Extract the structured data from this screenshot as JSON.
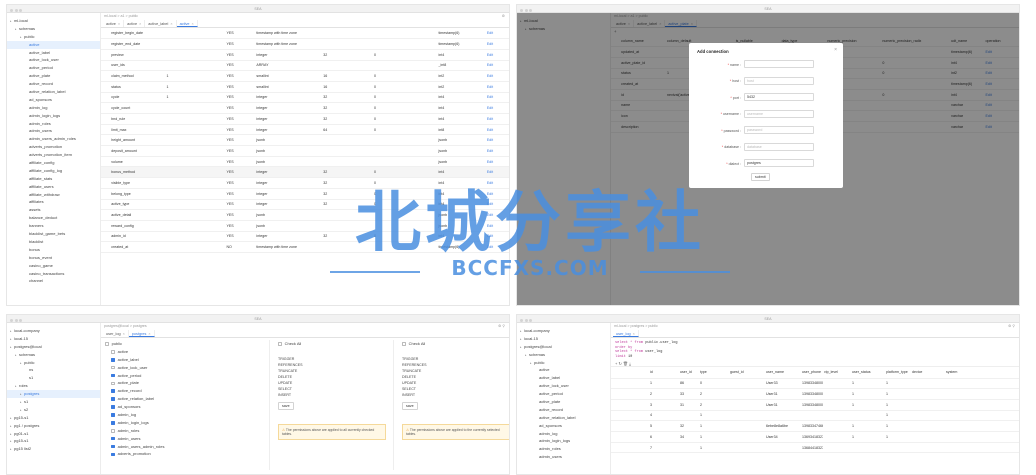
{
  "win_title": "SEA",
  "w1": {
    "breadcrumb": "ml-local > a1 > public",
    "settings_glyph": "⚙",
    "tree": [
      "ml-local",
      "schemas",
      "public",
      "active",
      "active_label",
      "active_lock_user",
      "active_period",
      "active_plate",
      "active_record",
      "active_relation_label",
      "ad_sponsors",
      "admin_log",
      "admin_login_logs",
      "admin_roles",
      "admin_users",
      "admin_users_admin_roles",
      "adverts_promotion",
      "adverts_promotion_item",
      "affiliate_config",
      "affiliate_config_log",
      "affiliate_stats",
      "affiliate_users",
      "affiliate_withdraw",
      "affiliates",
      "assets",
      "balance_deduct",
      "banners",
      "blacklist_game_bets",
      "blacklist",
      "bonus",
      "bonus_event",
      "casino_game",
      "casino_transactions",
      "channel"
    ],
    "tabs": [
      {
        "label": "active",
        "close": "×"
      },
      {
        "label": "active",
        "close": "×"
      },
      {
        "label": "active_label",
        "close": "×"
      },
      {
        "label": "active",
        "close": "×"
      }
    ],
    "rows": [
      [
        "",
        "register_begin_date",
        "",
        "YES",
        "timestamp with time zone",
        "",
        "",
        "timestamp(6)",
        "Edit"
      ],
      [
        "",
        "register_end_date",
        "",
        "YES",
        "timestamp with time zone",
        "",
        "",
        "timestamp(6)",
        "Edit"
      ],
      [
        "",
        "preview",
        "",
        "YES",
        "integer",
        "32",
        "0",
        "int4",
        "Edit"
      ],
      [
        "",
        "user_ids",
        "",
        "YES",
        "ARRAY",
        "",
        "",
        "_int8",
        "Edit"
      ],
      [
        "",
        "claim_method",
        "1",
        "YES",
        "smallint",
        "16",
        "0",
        "int2",
        "Edit"
      ],
      [
        "",
        "status",
        "1",
        "YES",
        "smallint",
        "16",
        "0",
        "int2",
        "Edit"
      ],
      [
        "",
        "cycle",
        "1",
        "YES",
        "integer",
        "32",
        "0",
        "int4",
        "Edit"
      ],
      [
        "",
        "cycle_count",
        "",
        "YES",
        "integer",
        "32",
        "0",
        "int4",
        "Edit"
      ],
      [
        "",
        "bnd_rule",
        "",
        "YES",
        "integer",
        "32",
        "0",
        "int4",
        "Edit"
      ],
      [
        "",
        "limit_max",
        "",
        "YES",
        "integer",
        "64",
        "0",
        "int8",
        "Edit"
      ],
      [
        "",
        "height_amount",
        "",
        "YES",
        "jsonb",
        "",
        "",
        "jsonb",
        "Edit"
      ],
      [
        "",
        "deposit_amount",
        "",
        "YES",
        "jsonb",
        "",
        "",
        "jsonb",
        "Edit"
      ],
      [
        "",
        "volume",
        "",
        "YES",
        "jsonb",
        "",
        "",
        "jsonb",
        "Edit"
      ],
      [
        "",
        "bonus_method",
        "",
        "YES",
        "integer",
        "32",
        "0",
        "int4",
        "Edit"
      ],
      [
        "",
        "visible_type",
        "",
        "YES",
        "integer",
        "32",
        "0",
        "int4",
        "Edit"
      ],
      [
        "",
        "belong_type",
        "",
        "YES",
        "integer",
        "32",
        "0",
        "int4",
        "Edit"
      ],
      [
        "",
        "active_type",
        "",
        "YES",
        "integer",
        "32",
        "0",
        "int4",
        "Edit"
      ],
      [
        "",
        "active_detail",
        "",
        "YES",
        "jsonb",
        "",
        "",
        "jsonb",
        "Edit"
      ],
      [
        "",
        "reward_config",
        "",
        "YES",
        "jsonb",
        "",
        "",
        "jsonb",
        "Edit"
      ],
      [
        "",
        "admin_id",
        "",
        "YES",
        "integer",
        "32",
        "0",
        "int4",
        "Edit"
      ],
      [
        "",
        "created_at",
        "",
        "NO",
        "timestamp with time zone",
        "",
        "",
        "timestamp(6)",
        "Edit"
      ]
    ]
  },
  "w2": {
    "breadcrumb": "ml-local > a1 > public",
    "tree": [
      "ml-local",
      "schemas"
    ],
    "tabs": [
      {
        "label": "active",
        "close": "×"
      },
      {
        "label": "active_label",
        "close": "×"
      },
      {
        "label": "active_plate",
        "close": "×"
      }
    ],
    "add_glyph": "+",
    "headers": [
      "column_name",
      "column_default",
      "is_nullable",
      "data_type",
      "numeric_precision",
      "numeric_precision_radix",
      "udt_name",
      "operation"
    ],
    "rows": [
      [
        "updated_at",
        "",
        "",
        "",
        "",
        "",
        "timestamp(6)",
        "Edit"
      ],
      [
        "active_plate_id",
        "",
        "",
        "",
        "32",
        "0",
        "int4",
        "Edit"
      ],
      [
        "status",
        "1",
        "",
        "",
        "16",
        "0",
        "int2",
        "Edit"
      ],
      [
        "created_at",
        "",
        "",
        "",
        "",
        "",
        "timestamp(6)",
        "Edit"
      ],
      [
        "id",
        "nextval('active_plate_id_seq'::regclass)",
        "",
        "",
        "32",
        "0",
        "int4",
        "Edit"
      ],
      [
        "name",
        "",
        "",
        "",
        "",
        "",
        "varchar",
        "Edit"
      ],
      [
        "icon",
        "",
        "",
        "",
        "",
        "",
        "varchar",
        "Edit"
      ],
      [
        "description",
        "",
        "",
        "",
        "",
        "",
        "varchar",
        "Edit"
      ]
    ],
    "dialog": {
      "title": "Add connection",
      "close": "×",
      "fields": [
        {
          "label": "name",
          "value": "",
          "placeholder": ""
        },
        {
          "label": "host",
          "value": "",
          "placeholder": "host"
        },
        {
          "label": "port",
          "value": "5432",
          "placeholder": ""
        },
        {
          "label": "username",
          "value": "",
          "placeholder": "username"
        },
        {
          "label": "password",
          "value": "",
          "placeholder": "password"
        },
        {
          "label": "database",
          "value": "",
          "placeholder": "database"
        },
        {
          "label": "dialect",
          "value": "postgres",
          "placeholder": ""
        }
      ],
      "submit": "submit"
    }
  },
  "w3": {
    "breadcrumb": "postgres@local > postgres",
    "icons": "⚙ ⚲",
    "tree": [
      "local-company",
      "local-15",
      "postgres@local",
      "schemas",
      "public",
      "ns",
      "s1",
      "roles",
      "postgres",
      "s1",
      "s2",
      "pg15-s1",
      "pg1 / postgres",
      "pg01-s1",
      "pg15-s1",
      "pg15 list2"
    ],
    "tabs": [
      {
        "label": "user_log",
        "close": "×"
      },
      {
        "label": "postgres",
        "close": "×"
      }
    ],
    "perm_tree": [
      {
        "label": "public",
        "on": false
      },
      {
        "label": "active",
        "on": false
      },
      {
        "label": "active_label",
        "on": true
      },
      {
        "label": "active_lock_user",
        "on": false
      },
      {
        "label": "active_period",
        "on": true
      },
      {
        "label": "active_plate",
        "on": false
      },
      {
        "label": "active_record",
        "on": true
      },
      {
        "label": "active_relation_label",
        "on": true
      },
      {
        "label": "ad_sponsors",
        "on": true
      },
      {
        "label": "admin_log",
        "on": true
      },
      {
        "label": "admin_login_logs",
        "on": true
      },
      {
        "label": "admin_roles",
        "on": false
      },
      {
        "label": "admin_users",
        "on": true
      },
      {
        "label": "admin_users_admin_roles",
        "on": true
      },
      {
        "label": "adverts_promotion",
        "on": true
      }
    ],
    "panels": [
      {
        "check_all": "Check All",
        "items": [
          "TRIGGER",
          "REFERENCES",
          "TRUNCATE",
          "DELETE",
          "UPDATE",
          "SELECT",
          "INSERT"
        ],
        "save": "save",
        "warning": "The permissions above are applied to all currently checked tables."
      },
      {
        "check_all": "Check All",
        "items": [
          "TRIGGER",
          "REFERENCES",
          "TRUNCATE",
          "DELETE",
          "UPDATE",
          "SELECT",
          "INSERT"
        ],
        "save": "save",
        "warning": "The permissions above are applied to the currently selected tables."
      }
    ]
  },
  "w4": {
    "breadcrumb": "ml-local > postgres > public",
    "icons": "⚙ ⚲",
    "tree": [
      "local-company",
      "local-15",
      "postgres@local",
      "schemas",
      "public",
      "active",
      "active_label",
      "active_lock_user",
      "active_period",
      "active_plate",
      "active_record",
      "active_relation_label",
      "ad_sponsors",
      "admin_log",
      "admin_login_logs",
      "admin_roles",
      "admin_users"
    ],
    "tabs": [
      {
        "label": "user_log",
        "close": "×"
      }
    ],
    "sql": [
      [
        "select * from ",
        "public.user_log"
      ],
      [
        "order by ",
        ""
      ],
      [
        "select * from ",
        "user_log"
      ],
      [
        "limit ",
        "10"
      ]
    ],
    "toolbar": "+ ↻ 🗑 ⤓",
    "headers": [
      "",
      "id",
      "user_id",
      "type",
      "guest_id",
      "user_name",
      "user_phone",
      "vip_level",
      "user_status",
      "platform_type",
      "device",
      "system",
      "advertise_promotion_id"
    ],
    "rows": [
      [
        "",
        "1",
        "86",
        "0",
        "",
        "User33",
        "13983348000",
        "",
        "1",
        "1",
        "",
        "",
        ""
      ],
      [
        "",
        "2",
        "33",
        "2",
        "",
        "User31",
        "13983348000",
        "",
        "1",
        "1",
        "",
        "",
        ""
      ],
      [
        "",
        "3",
        "31",
        "2",
        "",
        "User31",
        "13983348000",
        "",
        "1",
        "1",
        "",
        "",
        ""
      ],
      [
        "",
        "4",
        "",
        "1",
        "",
        "",
        "",
        "",
        "",
        "1",
        "",
        "",
        ""
      ],
      [
        "",
        "5",
        "32",
        "1",
        "",
        "6ebe8e8a6be",
        "13983347466",
        "",
        "1",
        "1",
        "",
        "",
        ""
      ],
      [
        "",
        "6",
        "34",
        "1",
        "",
        "User34",
        "13693418327",
        "",
        "1",
        "1",
        "",
        "",
        ""
      ],
      [
        "",
        "7",
        "",
        "1",
        "",
        "",
        "13684418327",
        "",
        "",
        "",
        "",
        "",
        ""
      ]
    ]
  },
  "watermark": {
    "cn": "北城分享社",
    "en": "BCCFXS.COM"
  }
}
